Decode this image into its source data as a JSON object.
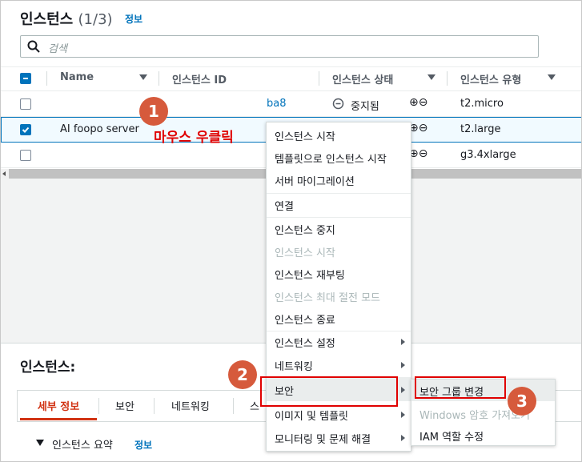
{
  "header": {
    "title": "인스턴스",
    "count": "(1/3)",
    "info_link": "정보"
  },
  "search": {
    "placeholder": "검색"
  },
  "table": {
    "columns": [
      "Name",
      "인스턴스 ID",
      "인스턴스 상태",
      "인스턴스 유형"
    ],
    "rows": [
      {
        "name": "",
        "id": "ba8",
        "status": "중지됨",
        "type": "t2.micro",
        "selected": false
      },
      {
        "name": "AI foopo server",
        "id": "",
        "status": "",
        "type": "t2.large",
        "selected": true
      },
      {
        "name": "",
        "id": "",
        "status": "",
        "type": "g3.4xlarge",
        "selected": false
      }
    ]
  },
  "context_menu": {
    "items": [
      {
        "label": "인스턴스 시작",
        "disabled": false
      },
      {
        "label": "템플릿으로 인스턴스 시작",
        "disabled": false
      },
      {
        "label": "서버 마이그레이션",
        "disabled": false
      },
      {
        "label": "연결",
        "disabled": false
      },
      {
        "label": "인스턴스 중지",
        "disabled": false
      },
      {
        "label": "인스턴스 시작",
        "disabled": true
      },
      {
        "label": "인스턴스 재부팅",
        "disabled": false
      },
      {
        "label": "인스턴스 최대 절전 모드",
        "disabled": true
      },
      {
        "label": "인스턴스 종료",
        "disabled": false
      },
      {
        "label": "인스턴스 설정",
        "disabled": false
      },
      {
        "label": "네트워킹",
        "disabled": false
      },
      {
        "label": "보안",
        "disabled": false
      },
      {
        "label": "이미지 및 템플릿",
        "disabled": false
      },
      {
        "label": "모니터링 및 문제 해결",
        "disabled": false
      }
    ]
  },
  "submenu": {
    "items": [
      {
        "label": "보안 그룹 변경",
        "disabled": false
      },
      {
        "label": "Windows 암호 가져오기",
        "disabled": true
      },
      {
        "label": "IAM 역할 수정",
        "disabled": false
      }
    ]
  },
  "details": {
    "title": "인스턴스:",
    "tabs": [
      "세부 정보",
      "보안",
      "네트워킹",
      "스"
    ],
    "summary": "인스턴스 요약",
    "summary_info": "정보"
  },
  "annotations": {
    "callout": "마우스 우클릭",
    "step1": "1",
    "step2": "2",
    "step3": "3"
  },
  "colors": {
    "accent": "#0073bb",
    "annotation_red": "#e00000",
    "badge": "#d65a3c",
    "active_tab": "#d13212"
  }
}
